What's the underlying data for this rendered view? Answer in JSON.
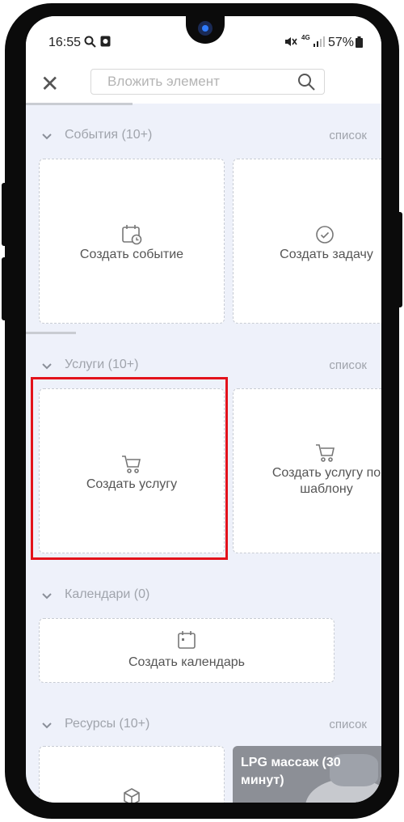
{
  "status_bar": {
    "time": "16:55",
    "signal_label": "4G",
    "battery_percent": "57%"
  },
  "top_bar": {
    "search_placeholder": "Вложить элемент"
  },
  "sections": {
    "events": {
      "title": "События (10+)",
      "list_label": "список",
      "cards": [
        "Создать событие",
        "Создать задачу"
      ]
    },
    "services": {
      "title": "Услуги (10+)",
      "list_label": "список",
      "cards": [
        "Создать услугу",
        "Создать услугу по шаблону"
      ]
    },
    "calendars": {
      "title": "Календари (0)",
      "cards": [
        "Создать календарь"
      ]
    },
    "resources": {
      "title": "Ресурсы (10+)",
      "list_label": "список",
      "photo_card_title": "LPG массаж (30 минут)"
    }
  },
  "colors": {
    "highlight": "#e3121b",
    "background": "#eef1fa"
  }
}
